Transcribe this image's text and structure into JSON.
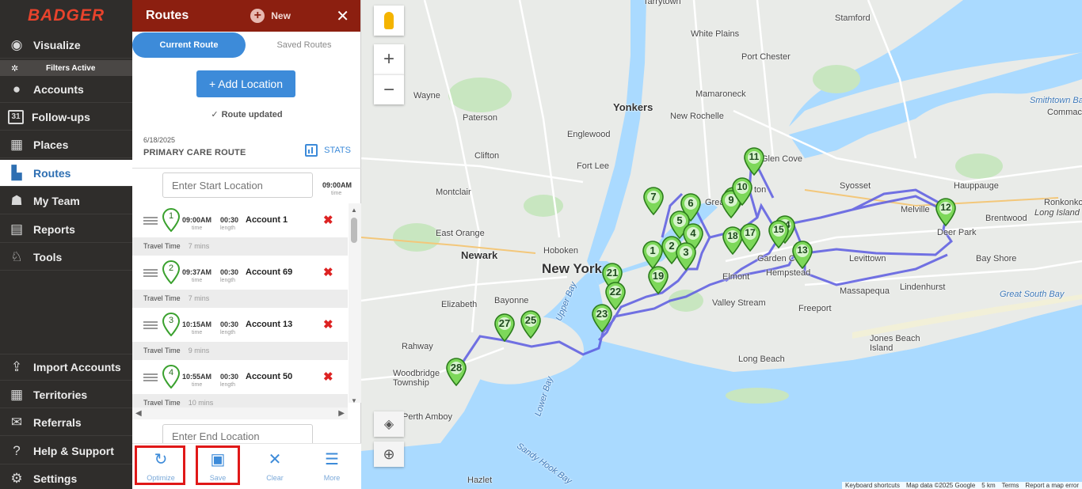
{
  "brand": {
    "logo_text": "BADGER",
    "accent": "#e8432c"
  },
  "nav": {
    "items": [
      {
        "label": "Visualize",
        "icon": "eye-icon"
      },
      {
        "label": "Accounts",
        "icon": "person-icon"
      },
      {
        "label": "Follow-ups",
        "icon": "calendar-icon",
        "badge": "31"
      },
      {
        "label": "Places",
        "icon": "store-icon"
      },
      {
        "label": "Routes",
        "icon": "map-icon",
        "active": true
      },
      {
        "label": "My Team",
        "icon": "team-icon"
      },
      {
        "label": "Reports",
        "icon": "report-icon"
      },
      {
        "label": "Tools",
        "icon": "tools-icon"
      }
    ],
    "filters_label": "Filters Active",
    "bottom_items": [
      {
        "label": "Import Accounts",
        "icon": "upload-icon"
      },
      {
        "label": "Territories",
        "icon": "grid-icon"
      },
      {
        "label": "Referrals",
        "icon": "referral-icon"
      },
      {
        "label": "Help & Support",
        "icon": "help-icon"
      },
      {
        "label": "Settings",
        "icon": "gear-icon"
      }
    ]
  },
  "panel": {
    "title": "Routes",
    "new_label": "New",
    "close_glyph": "✕",
    "tabs": {
      "current": "Current Route",
      "saved": "Saved Routes"
    },
    "add_location": "+ Add Location",
    "status": "Route updated",
    "route_date": "6/18/2025",
    "route_name": "PRIMARY CARE ROUTE",
    "stats_label": "STATS",
    "start_placeholder": "Enter Start Location",
    "start_time": "09:00AM",
    "time_caption": "time",
    "length_caption": "length",
    "travel_label": "Travel Time",
    "stops": [
      {
        "num": "1",
        "time": "09:00AM",
        "length": "00:30",
        "account": "Account 1",
        "travel": "7 mins"
      },
      {
        "num": "2",
        "time": "09:37AM",
        "length": "00:30",
        "account": "Account 69",
        "travel": "7 mins"
      },
      {
        "num": "3",
        "time": "10:15AM",
        "length": "00:30",
        "account": "Account 13",
        "travel": "9 mins"
      },
      {
        "num": "4",
        "time": "10:55AM",
        "length": "00:30",
        "account": "Account 50",
        "travel": "10 mins"
      }
    ],
    "end_placeholder": "Enter End Location",
    "actions": [
      {
        "label": "Optimize",
        "icon": "optimize-icon",
        "glyph": "↻"
      },
      {
        "label": "Save",
        "icon": "save-icon",
        "glyph": "▣"
      },
      {
        "label": "Clear",
        "icon": "clear-icon",
        "glyph": "✕"
      },
      {
        "label": "More",
        "icon": "more-icon",
        "glyph": "☰"
      }
    ]
  },
  "map": {
    "zoom_in": "+",
    "zoom_out": "−",
    "labels": {
      "tarrytown": "Tarrytown",
      "stamford": "Stamford",
      "white_plains": "White Plains",
      "port_chester": "Port Chester",
      "wayne": "Wayne",
      "yonkers": "Yonkers",
      "mamaroneck": "Mamaroneck",
      "smithtown_bay": "Smithtown Bay",
      "paterson": "Paterson",
      "new_rochelle": "New Rochelle",
      "commack": "Commack",
      "clifton": "Clifton",
      "englewood": "Englewood",
      "glen_cove": "Glen Cove",
      "fort_lee": "Fort Lee",
      "syosset": "Syosset",
      "hauppauge": "Hauppauge",
      "ronkonkoma": "Ronkonkoma",
      "montclair": "Montclair",
      "melville": "Melville",
      "brentwood": "Brentwood",
      "long_island": "Long Island",
      "deer_park": "Deer Park",
      "east_orange": "East Orange",
      "newark": "Newark",
      "hoboken": "Hoboken",
      "new_york": "New York",
      "levittown": "Levittown",
      "bay_shore": "Bay Shore",
      "garden_city": "Garden C",
      "hempstead": "Hempstead",
      "elmont": "Elmont",
      "lindenhurst": "Lindenhurst",
      "massapequa": "Massapequa",
      "bayonne": "Bayonne",
      "valley_stream": "Valley Stream",
      "freeport": "Freeport",
      "great_south_bay": "Great South Bay",
      "elizabeth": "Elizabeth",
      "upper_bay": "Upper Bay",
      "rahway": "Rahway",
      "jones_beach": "Jones Beach Island",
      "long_beach": "Long Beach",
      "woodbridge": "Woodbridge Township",
      "lower_bay": "Lower Bay",
      "perth_amboy": "Perth Amboy",
      "sandy_hook": "Sandy Hook Bay",
      "hazlet": "Hazlet",
      "great_neck": "Great",
      "roslyn": "ton"
    },
    "markers": [
      "1",
      "2",
      "3",
      "4",
      "5",
      "6",
      "7",
      "8",
      "9",
      "10",
      "11",
      "12",
      "13",
      "14",
      "15",
      "17",
      "18",
      "19",
      "21",
      "22",
      "23",
      "25",
      "27",
      "28"
    ],
    "attribution": [
      "Keyboard shortcuts",
      "Map data ©2025 Google",
      "5 km",
      "Terms",
      "Report a map error"
    ],
    "colors": {
      "water": "#aadaff",
      "land": "#e8eae8",
      "park": "#c8e6c0",
      "route": "#5b5be0",
      "marker": "#7dd85a"
    }
  }
}
